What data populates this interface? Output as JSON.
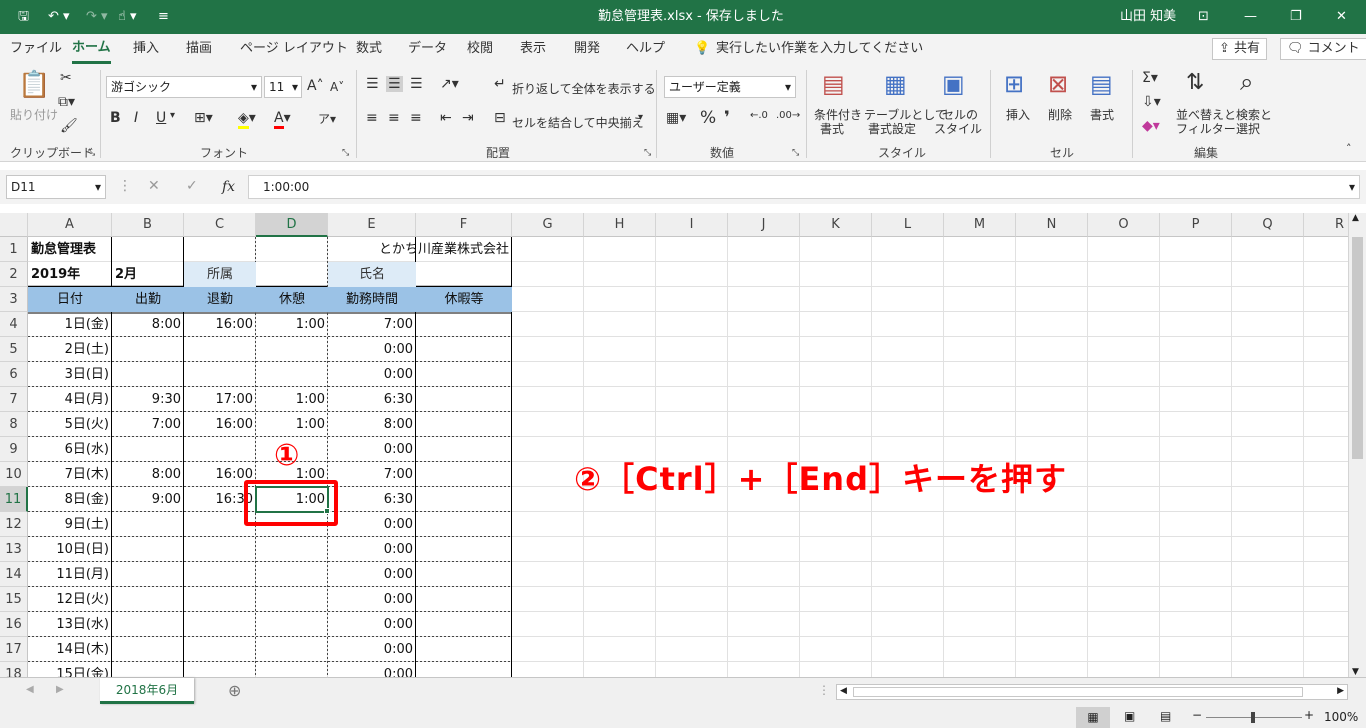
{
  "titlebar": {
    "title": "勤怠管理表.xlsx  -  保存しました",
    "user": "山田 知美"
  },
  "menu": {
    "items": [
      "ファイル",
      "ホーム",
      "挿入",
      "描画",
      "ページ レイアウト",
      "数式",
      "データ",
      "校閲",
      "表示",
      "開発",
      "ヘルプ"
    ],
    "tell_me": "実行したい作業を入力してください",
    "share": "共有",
    "comment": "コメント"
  },
  "ribbon": {
    "clipboard": {
      "paste": "貼り付け",
      "group": "クリップボード"
    },
    "font": {
      "name": "游ゴシック",
      "size": "11",
      "bold": "B",
      "italic": "I",
      "underline": "U",
      "grow": "A",
      "shrink": "A",
      "group": "フォント"
    },
    "alignment": {
      "wrap": "折り返して全体を表示する",
      "merge": "セルを結合して中央揃え",
      "group": "配置"
    },
    "number": {
      "format": "ユーザー定義",
      "group": "数値"
    },
    "styles": {
      "cond1": "条件付き",
      "cond2": "書式",
      "table1": "テーブルとして",
      "table2": "書式設定",
      "cell1": "セルの",
      "cell2": "スタイル",
      "group": "スタイル"
    },
    "cells": {
      "insert": "挿入",
      "delete": "削除",
      "format": "書式",
      "group": "セル"
    },
    "editing": {
      "sort1": "並べ替えと",
      "sort2": "フィルター",
      "find1": "検索と",
      "find2": "選択",
      "group": "編集"
    }
  },
  "formula_bar": {
    "name_box": "D11",
    "fx": "fx",
    "value": "1:00:00"
  },
  "columns": [
    "A",
    "B",
    "C",
    "D",
    "E",
    "F",
    "G",
    "H",
    "I",
    "J",
    "K",
    "L",
    "M",
    "N",
    "O",
    "P",
    "Q",
    "R"
  ],
  "rows": [
    "1",
    "2",
    "3",
    "4",
    "5",
    "6",
    "7",
    "8",
    "9",
    "10",
    "11",
    "12",
    "13",
    "14",
    "15",
    "16",
    "17",
    "18"
  ],
  "sheet": {
    "title": "勤怠管理表",
    "company": "とかち川産業株式会社",
    "year": "2019年",
    "month": "2月",
    "dept_label": "所属",
    "name_label": "氏名",
    "headers": [
      "日付",
      "出勤",
      "退勤",
      "休憩",
      "勤務時間",
      "休暇等"
    ],
    "data": [
      [
        "1日(金)",
        "8:00",
        "16:00",
        "1:00",
        "7:00"
      ],
      [
        "2日(土)",
        "",
        "",
        "",
        "0:00"
      ],
      [
        "3日(日)",
        "",
        "",
        "",
        "0:00"
      ],
      [
        "4日(月)",
        "9:30",
        "17:00",
        "1:00",
        "6:30"
      ],
      [
        "5日(火)",
        "7:00",
        "16:00",
        "1:00",
        "8:00"
      ],
      [
        "6日(水)",
        "",
        "",
        "",
        "0:00"
      ],
      [
        "7日(木)",
        "8:00",
        "16:00",
        "1:00",
        "7:00"
      ],
      [
        "8日(金)",
        "9:00",
        "16:30",
        "1:00",
        "6:30"
      ],
      [
        "9日(土)",
        "",
        "",
        "",
        "0:00"
      ],
      [
        "10日(日)",
        "",
        "",
        "",
        "0:00"
      ],
      [
        "11日(月)",
        "",
        "",
        "",
        "0:00"
      ],
      [
        "12日(火)",
        "",
        "",
        "",
        "0:00"
      ],
      [
        "13日(水)",
        "",
        "",
        "",
        "0:00"
      ],
      [
        "14日(木)",
        "",
        "",
        "",
        "0:00"
      ],
      [
        "15日(金)",
        "",
        "",
        "",
        "0:00"
      ]
    ]
  },
  "annotations": {
    "step1": "①",
    "step2": "②［Ctrl］+［End］キーを押す"
  },
  "tabs": {
    "sheet": "2018年6月",
    "add": "⊕"
  },
  "status": {
    "zoom": "100%"
  },
  "colors": {
    "accent": "#217346",
    "header_fill": "#9bc2e6",
    "label_fill": "#ddebf7",
    "annotation": "#ff0000"
  }
}
